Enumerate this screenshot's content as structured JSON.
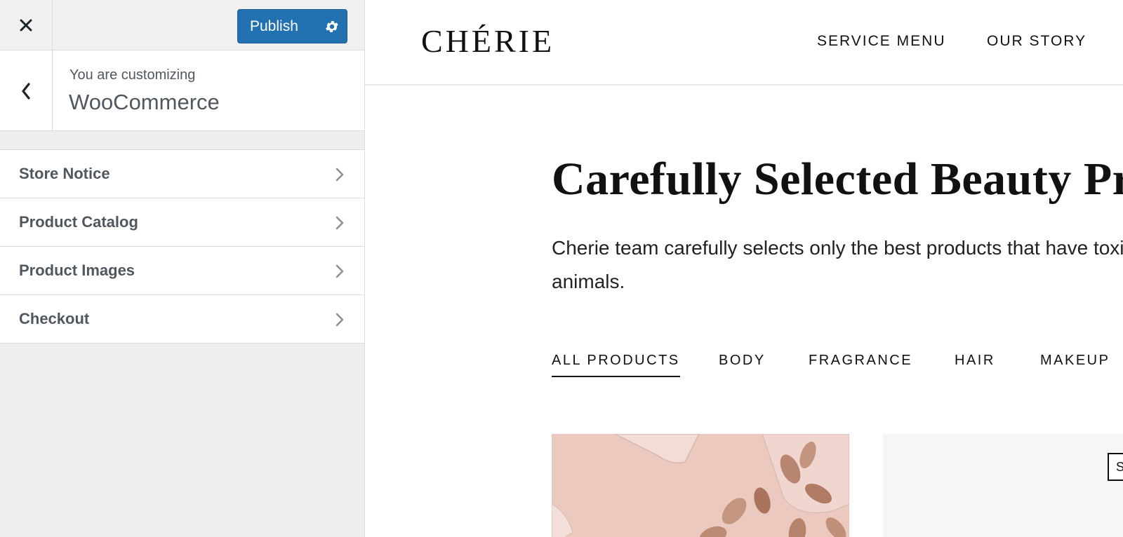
{
  "customizer": {
    "close_icon": "close-icon",
    "publish_label": "Publish",
    "publish_settings_icon": "gear-icon",
    "back_icon": "chevron-left-icon",
    "customizing_label": "You are customizing",
    "customizing_title": "WooCommerce",
    "sections": [
      {
        "label": "Store Notice"
      },
      {
        "label": "Product Catalog"
      },
      {
        "label": "Product Images"
      },
      {
        "label": "Checkout"
      }
    ],
    "accent_color": "#2271b1"
  },
  "site": {
    "logo": "CHÉRIE",
    "nav": [
      "SERVICE MENU",
      "OUR STORY"
    ],
    "hero_title": "Carefully Selected Beauty Pro",
    "hero_text": "Cherie team carefully selects only the best products that have toxic-fr animals.",
    "filter_tabs": [
      "ALL PRODUCTS",
      "BODY",
      "FRAGRANCE",
      "HAIR",
      "MAKEUP"
    ],
    "active_tab": "ALL PRODUCTS",
    "badge_text": "S"
  }
}
